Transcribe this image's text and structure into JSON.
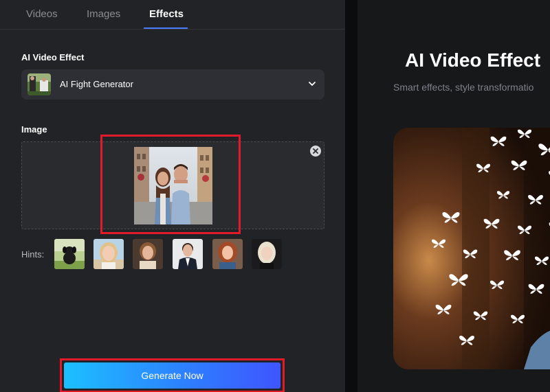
{
  "tabs": [
    {
      "label": "Videos",
      "active": false
    },
    {
      "label": "Images",
      "active": false
    },
    {
      "label": "Effects",
      "active": true
    }
  ],
  "accent_color": "#4b7bff",
  "highlight_color": "#e11b2a",
  "effect_section": {
    "label": "AI Video Effect",
    "selected_value": "AI Fight Generator",
    "thumbnail_icon": "fight-scene-thumbnail",
    "chevron_icon": "chevron-down-icon"
  },
  "image_section": {
    "label": "Image",
    "uploaded_image": "couple-photo",
    "remove_icon": "close-icon"
  },
  "hints": {
    "label": "Hints:",
    "items": [
      {
        "name": "puppy"
      },
      {
        "name": "girl-blonde"
      },
      {
        "name": "woman-vintage"
      },
      {
        "name": "man-suit"
      },
      {
        "name": "woman-redhead"
      },
      {
        "name": "woman-platinum"
      }
    ]
  },
  "generate_button": {
    "label": "Generate Now",
    "gradient_start": "#1cc0ff",
    "gradient_end": "#3f55ff"
  },
  "preview_panel": {
    "title": "AI Video Effect",
    "subtitle": "Smart effects, style transformatio",
    "preview_image": "butterflies-scene"
  }
}
